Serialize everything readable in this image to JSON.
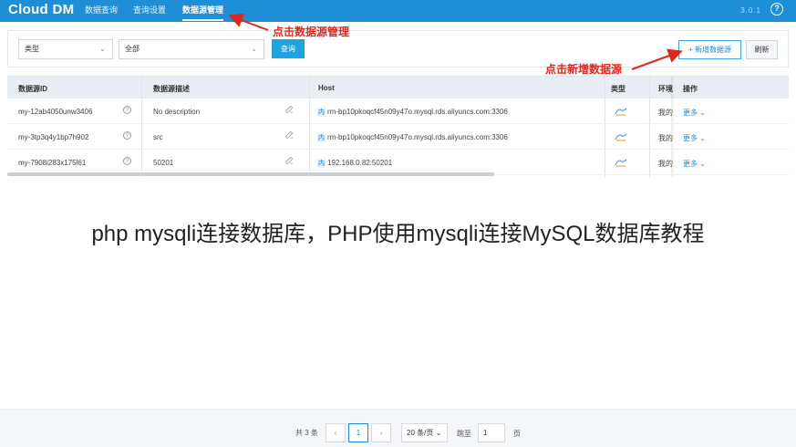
{
  "topbar": {
    "brand": "Cloud DM",
    "nav": [
      "数据查询",
      "查询设置",
      "数据源管理"
    ],
    "version": "3.0.1",
    "help_icon": "question-circle-icon",
    "help_glyph": "?"
  },
  "filter": {
    "type_select": "类型",
    "scope_select": "全部",
    "query_label": "查询",
    "add_label": "+ 新增数据源",
    "refresh_label": "刷新",
    "caret": "⌄"
  },
  "table": {
    "columns": [
      "数据源ID",
      "数据源描述",
      "Host",
      "类型",
      "环境",
      "操作"
    ],
    "rows": [
      {
        "id": "my-12ab4050unw3406",
        "desc": "No description",
        "host_tag": "内",
        "host": "rm-bp10pkoqcf45n09y47o.mysql.rds.aliyuncs.com:3306",
        "env": "我的",
        "action": "更多 ⌄"
      },
      {
        "id": "my-3tp3q4y1bp7h902",
        "desc": "src",
        "host_tag": "内",
        "host": "rm-bp10pkoqcf45n09y47o.mysql.rds.aliyuncs.com:3306",
        "env": "我的",
        "action": "更多 ⌄"
      },
      {
        "id": "my-7908i283x175l61",
        "desc": "50201",
        "host_tag": "内",
        "host": "192.168.0.82:50201",
        "env": "我的",
        "action": "更多 ⌄"
      }
    ]
  },
  "annotations": {
    "nav_note": "点击数据源管理",
    "add_note": "点击新增数据源",
    "color": "#e0271e"
  },
  "watermark": "php mysqli连接数据库，PHP使用mysqli连接MySQL数据库教程",
  "pagination": {
    "total": "共 3 条",
    "prev": "‹",
    "current": "1",
    "next": "›",
    "page_size": "20 条/页 ⌄",
    "jump_label": "跳至",
    "jump_value": "1",
    "page_suffix": "页"
  },
  "colors": {
    "header_blue": "#1e8fd6",
    "button_blue": "#1fa3e0",
    "annotation_red": "#e0271e"
  }
}
